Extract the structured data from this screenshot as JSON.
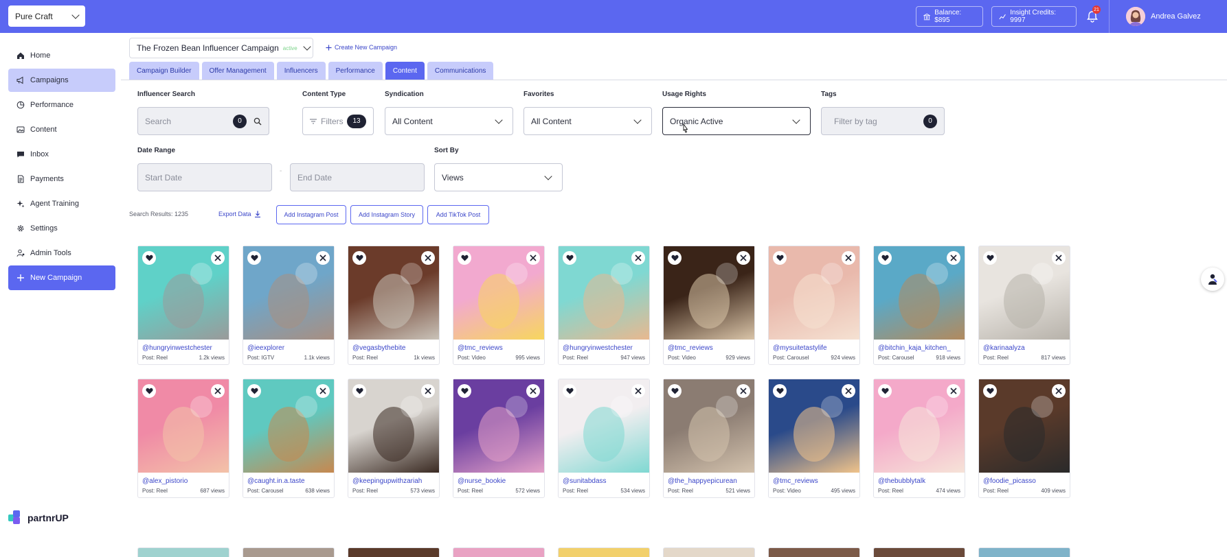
{
  "brand": {
    "label": "Pure Craft"
  },
  "topbar": {
    "balance": "Balance: $895",
    "insight_credits": "Insight Credits: 9997",
    "notifications_count": "21",
    "user_name": "Andrea Galvez"
  },
  "sidebar": {
    "items": [
      {
        "label": "Home",
        "icon": "home-icon"
      },
      {
        "label": "Campaigns",
        "icon": "megaphone-icon"
      },
      {
        "label": "Performance",
        "icon": "chart-icon"
      },
      {
        "label": "Content",
        "icon": "image-icon"
      },
      {
        "label": "Inbox",
        "icon": "chat-icon"
      },
      {
        "label": "Payments",
        "icon": "document-icon"
      },
      {
        "label": "Agent Training",
        "icon": "sparkle-icon"
      },
      {
        "label": "Settings",
        "icon": "gear-icon"
      },
      {
        "label": "Admin Tools",
        "icon": "person-gear-icon"
      }
    ],
    "new_campaign": "New Campaign",
    "logo_text": "partnrUP"
  },
  "campaign": {
    "name": "The Frozen Bean Influencer Campaign",
    "status": "active",
    "create_new": "Create New Campaign"
  },
  "tabs": [
    "Campaign Builder",
    "Offer Management",
    "Influencers",
    "Performance",
    "Content",
    "Communications"
  ],
  "filters": {
    "influencer_search": {
      "label": "Influencer Search",
      "placeholder": "Search",
      "count": "0"
    },
    "content_type": {
      "label": "Content Type",
      "placeholder": "Filters",
      "count": "13"
    },
    "syndication": {
      "label": "Syndication",
      "value": "All Content"
    },
    "favorites": {
      "label": "Favorites",
      "value": "All Content"
    },
    "usage_rights": {
      "label": "Usage Rights",
      "value": "Organic Active"
    },
    "tags": {
      "label": "Tags",
      "placeholder": "Filter by tag",
      "count": "0"
    },
    "date_range": {
      "label": "Date Range",
      "start_placeholder": "Start Date",
      "end_placeholder": "End Date",
      "separator": "-"
    },
    "sort_by": {
      "label": "Sort By",
      "value": "Views"
    }
  },
  "results": {
    "label": "Search Results: 1235",
    "export": "Export Data",
    "add_instagram_post": "Add Instagram Post",
    "add_instagram_story": "Add Instagram Story",
    "add_tiktok_post": "Add TikTok Post"
  },
  "cards": [
    {
      "handle": "@hungryinwestchester",
      "meta": "Post: Reel",
      "views": "1.2k views",
      "colors": [
        "#5fd1c8",
        "#9a9a9a"
      ]
    },
    {
      "handle": "@ieexplorer",
      "meta": "Post: IGTV",
      "views": "1.1k views",
      "colors": [
        "#6fa6c9",
        "#a88f82"
      ]
    },
    {
      "handle": "@vegasbythebite",
      "meta": "Post: Reel",
      "views": "1k views",
      "colors": [
        "#6b3b2a",
        "#c9c2b8"
      ]
    },
    {
      "handle": "@tmc_reviews",
      "meta": "Post: Video",
      "views": "995 views",
      "colors": [
        "#f2a9cf",
        "#f7d65e"
      ]
    },
    {
      "handle": "@hungryinwestchester",
      "meta": "Post: Reel",
      "views": "947 views",
      "colors": [
        "#7fd8d2",
        "#e8b88f"
      ]
    },
    {
      "handle": "@tmc_reviews",
      "meta": "Post: Video",
      "views": "929 views",
      "colors": [
        "#3a2418",
        "#d9c4a8"
      ]
    },
    {
      "handle": "@mysuitetastylife",
      "meta": "Post: Carousel",
      "views": "924 views",
      "colors": [
        "#e9b9ac",
        "#f5e1d2"
      ]
    },
    {
      "handle": "@bitchin_kaja_kitchen_",
      "meta": "Post: Carousel",
      "views": "918 views",
      "colors": [
        "#5aa9c7",
        "#b28a5e"
      ]
    },
    {
      "handle": "@karinaalyza",
      "meta": "Post: Reel",
      "views": "817 views",
      "colors": [
        "#e8e4df",
        "#b7b2aa"
      ]
    },
    {
      "handle": "@alex_pistorio",
      "meta": "Post: Reel",
      "views": "687 views",
      "colors": [
        "#f08aa6",
        "#f3c2a8"
      ]
    },
    {
      "handle": "@caught.in.a.taste",
      "meta": "Post: Carousel",
      "views": "638 views",
      "colors": [
        "#5fc9c0",
        "#c7884f"
      ]
    },
    {
      "handle": "@keepingupwithzariah",
      "meta": "Post: Reel",
      "views": "573 views",
      "colors": [
        "#d8d4cf",
        "#3a2a22"
      ]
    },
    {
      "handle": "@nurse_bookie",
      "meta": "Post: Reel",
      "views": "572 views",
      "colors": [
        "#6a3ea0",
        "#e3a0c7"
      ]
    },
    {
      "handle": "@sunitabdass",
      "meta": "Post: Reel",
      "views": "534 views",
      "colors": [
        "#f2eef0",
        "#7fd8d2"
      ]
    },
    {
      "handle": "@the_happyepicurean",
      "meta": "Post: Reel",
      "views": "521 views",
      "colors": [
        "#8b7c72",
        "#d3c2ad"
      ]
    },
    {
      "handle": "@tmc_reviews",
      "meta": "Post: Video",
      "views": "495 views",
      "colors": [
        "#2a4a8a",
        "#f0c38a"
      ]
    },
    {
      "handle": "@thebubblytalk",
      "meta": "Post: Reel",
      "views": "474 views",
      "colors": [
        "#f4a9c9",
        "#f6e3d8"
      ]
    },
    {
      "handle": "@foodie_picasso",
      "meta": "Post: Reel",
      "views": "409 views",
      "colors": [
        "#5a3a2a",
        "#2a2a2a"
      ]
    }
  ],
  "bottom_stub_colors": [
    "#9fd2cf",
    "#a99a8f",
    "#5a3a2a",
    "#e9a2c3",
    "#f2d06b",
    "#e4d8c9",
    "#7c5a48",
    "#6b4a3a",
    "#7fb3c9"
  ]
}
